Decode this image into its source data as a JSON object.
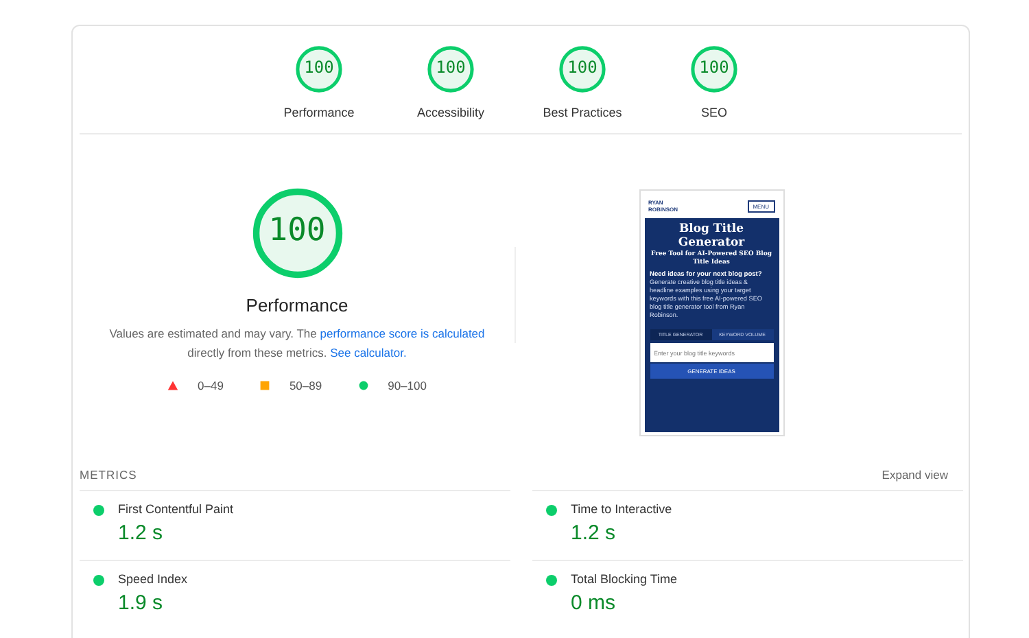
{
  "categories": [
    {
      "label": "Performance",
      "score": "100",
      "level": 1
    },
    {
      "label": "Accessibility",
      "score": "100",
      "level": 1
    },
    {
      "label": "Best Practices",
      "score": "100",
      "level": 1
    },
    {
      "label": "SEO",
      "score": "100",
      "level": 1
    }
  ],
  "main_gauge": {
    "score": "100",
    "level": 1,
    "title": "Performance"
  },
  "description": {
    "text": "Values are estimated and may vary. The ",
    "link1": "performance score is calculated",
    "middle": " directly from these metrics. ",
    "link2": "See calculator."
  },
  "legend": [
    {
      "kind": "triangle",
      "range": "0–49",
      "color": "#ff3333"
    },
    {
      "kind": "square",
      "range": "50–89",
      "color": "#ffa400"
    },
    {
      "kind": "circle",
      "range": "90–100",
      "color": "#0cce6b"
    }
  ],
  "screenshot": {
    "brand": "RYAN ROBINSON",
    "menu": "MENU",
    "heading": "Blog Title Generator",
    "subheading": "Free Tool for AI-Powered SEO Blog Title Ideas",
    "lead": "Need ideas for your next blog post?",
    "body": "Generate creative blog title ideas & headline examples using your target keywords with this free AI-powered SEO blog title generator tool from Ryan Robinson.",
    "tabs": [
      {
        "label": "TITLE GENERATOR",
        "selected": true
      },
      {
        "label": "KEYWORD VOLUME",
        "selected": false
      }
    ],
    "placeholder": "Enter your blog title keywords",
    "button": "GENERATE IDEAS"
  },
  "metrics": {
    "heading": "METRICS",
    "toggle": "Expand view",
    "items": [
      {
        "name": "First Contentful Paint",
        "value": "1.2 s",
        "color": "#0cce6b"
      },
      {
        "name": "Time to Interactive",
        "value": "1.2 s",
        "color": "#0cce6b"
      },
      {
        "name": "Speed Index",
        "value": "1.9 s",
        "color": "#0cce6b"
      },
      {
        "name": "Total Blocking Time",
        "value": "0 ms",
        "color": "#0cce6b"
      }
    ]
  }
}
